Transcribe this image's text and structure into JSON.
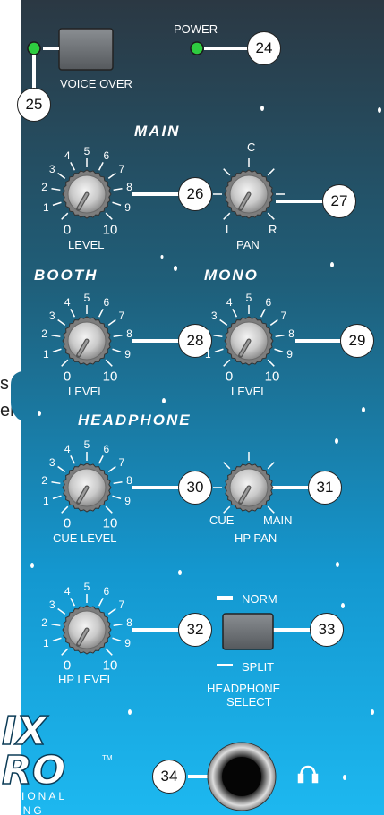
{
  "left_edge_text": [
    "s",
    "er"
  ],
  "buttons": {
    "voice_over": "VOICE OVER",
    "power": "POWER"
  },
  "sections": {
    "main": "MAIN",
    "booth": "BOOTH",
    "mono": "MONO",
    "headphone": "HEADPHONE"
  },
  "knob_labels": {
    "level": "LEVEL",
    "pan": "PAN",
    "cue_level": "CUE LEVEL",
    "hp_pan": "HP PAN",
    "hp_level": "HP LEVEL"
  },
  "scale": [
    "0",
    "1",
    "2",
    "3",
    "4",
    "5",
    "6",
    "7",
    "8",
    "9",
    "10"
  ],
  "pan_marks": {
    "center": "C",
    "left": "L",
    "right": "R",
    "cue": "CUE",
    "main": "MAIN"
  },
  "headphone_select": {
    "norm": "NORM",
    "split": "SPLIT",
    "title_line1": "HEADPHONE",
    "title_line2": "SELECT"
  },
  "callouts": [
    "24",
    "25",
    "26",
    "27",
    "28",
    "29",
    "30",
    "31",
    "32",
    "33",
    "34"
  ],
  "logo": {
    "line1": "IX",
    "line2": "RO",
    "tm": "TM",
    "tag1": "SSIONAL",
    "tag2": "IXING"
  },
  "colors": {
    "panel_top": "#2a3a44",
    "panel_bottom": "#19b4ee",
    "led_green": "#2ecc40",
    "button_gray": "#6e7276"
  }
}
